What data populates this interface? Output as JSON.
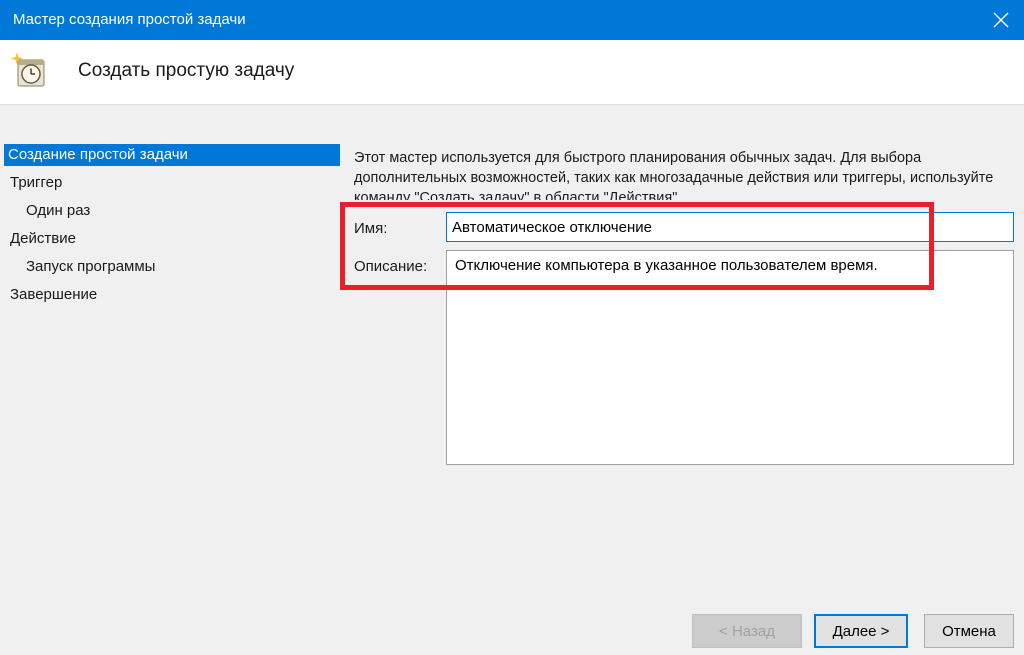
{
  "window": {
    "title": "Мастер создания простой задачи"
  },
  "header": {
    "title": "Создать простую задачу",
    "icon": "task-scheduler-clock-icon"
  },
  "nav": {
    "items": [
      {
        "label": "Создание простой задачи",
        "selected": true
      },
      {
        "label": "Триггер"
      },
      {
        "label": "Один раз"
      },
      {
        "label": "Действие"
      },
      {
        "label": "Запуск программы"
      },
      {
        "label": "Завершение"
      }
    ]
  },
  "main": {
    "intro": "Этот мастер используется для быстрого планирования обычных задач.  Для выбора дополнительных возможностей, таких как многозадачные действия или триггеры, используйте команду \"Создать задачу\" в области \"Действия\".",
    "name_label": "Имя:",
    "name_value": "Автоматическое отключение",
    "desc_label": "Описание:",
    "desc_value": "Отключение компьютера в указанное пользователем время."
  },
  "buttons": {
    "back": "< Назад",
    "next": "Далее >",
    "cancel": "Отмена"
  },
  "colors": {
    "accent": "#0078d7",
    "highlight": "#e8202e"
  }
}
